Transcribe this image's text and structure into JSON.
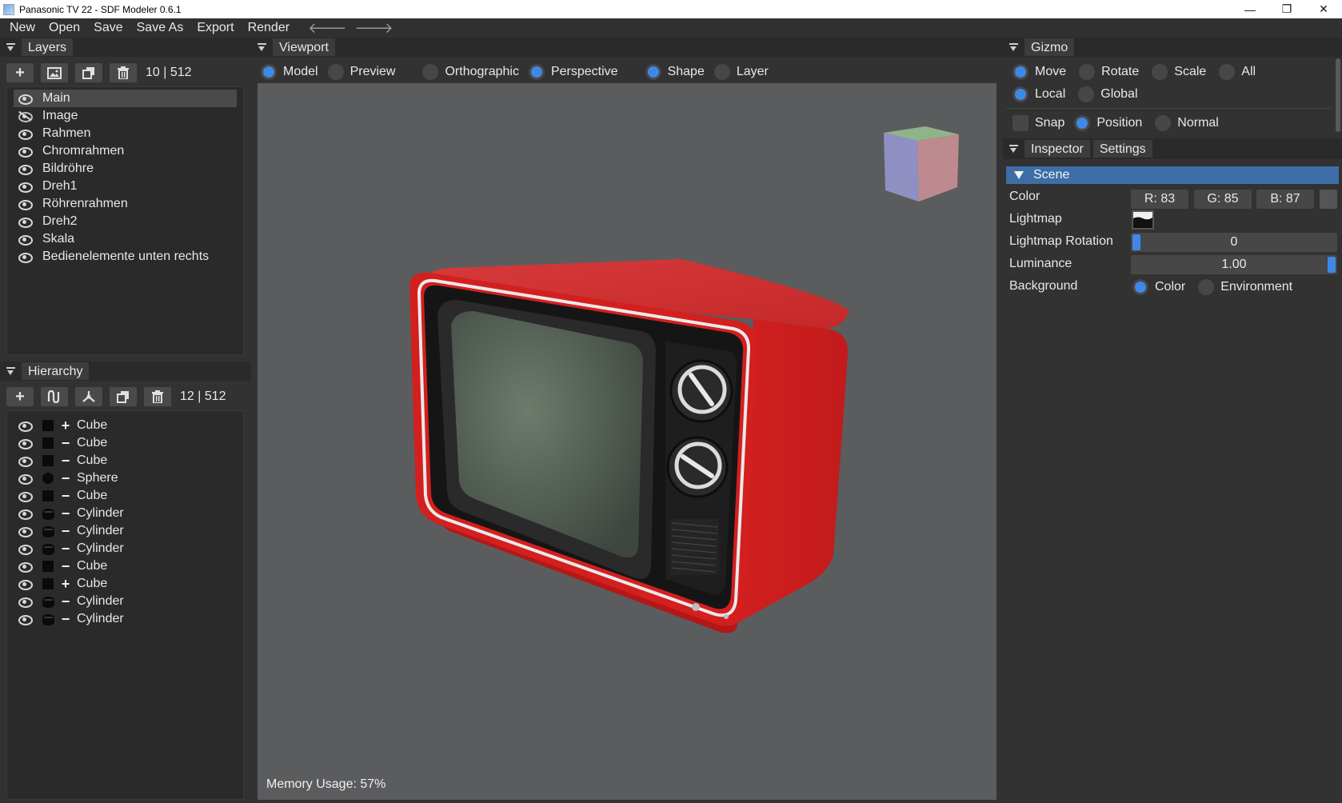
{
  "window": {
    "title": "Panasonic TV 22 - SDF Modeler 0.6.1",
    "minimize": "—",
    "maximize": "❐",
    "close": "✕"
  },
  "menu": {
    "items": [
      "New",
      "Open",
      "Save",
      "Save As",
      "Export",
      "Render"
    ],
    "back": "🡐",
    "forward": "🡒"
  },
  "layers": {
    "title": "Layers",
    "count": "10 | 512",
    "items": [
      {
        "label": "Main",
        "visible": true,
        "selected": true
      },
      {
        "label": "Image",
        "visible": false
      },
      {
        "label": "Rahmen",
        "visible": true
      },
      {
        "label": "Chromrahmen",
        "visible": true
      },
      {
        "label": "Bildröhre",
        "visible": true
      },
      {
        "label": "Dreh1",
        "visible": true
      },
      {
        "label": "Röhrenrahmen",
        "visible": true
      },
      {
        "label": "Dreh2",
        "visible": true
      },
      {
        "label": "Skala",
        "visible": true
      },
      {
        "label": "Bedienelemente unten rechts",
        "visible": true
      }
    ]
  },
  "hierarchy": {
    "title": "Hierarchy",
    "count": "12 | 512",
    "items": [
      {
        "shape": "square",
        "op": "+",
        "label": "Cube"
      },
      {
        "shape": "square",
        "op": "−",
        "label": "Cube"
      },
      {
        "shape": "square",
        "op": "−",
        "label": "Cube"
      },
      {
        "shape": "circle",
        "op": "−",
        "label": "Sphere"
      },
      {
        "shape": "square",
        "op": "−",
        "label": "Cube"
      },
      {
        "shape": "cylinder",
        "op": "−",
        "label": "Cylinder"
      },
      {
        "shape": "cylinder",
        "op": "−",
        "label": "Cylinder"
      },
      {
        "shape": "cylinder",
        "op": "−",
        "label": "Cylinder"
      },
      {
        "shape": "square",
        "op": "−",
        "label": "Cube"
      },
      {
        "shape": "square",
        "op": "+",
        "label": "Cube"
      },
      {
        "shape": "cylinder",
        "op": "−",
        "label": "Cylinder"
      },
      {
        "shape": "cylinder",
        "op": "−",
        "label": "Cylinder"
      }
    ]
  },
  "viewport": {
    "title": "Viewport",
    "options": [
      {
        "label": "Model",
        "on": true
      },
      {
        "label": "Preview",
        "on": false
      },
      {
        "label": "Orthographic",
        "on": false
      },
      {
        "label": "Perspective",
        "on": true
      },
      {
        "label": "Shape",
        "on": true
      },
      {
        "label": "Layer",
        "on": false
      }
    ],
    "memory": "Memory Usage: 57%"
  },
  "gizmo": {
    "title": "Gizmo",
    "row1": [
      {
        "label": "Move",
        "on": true
      },
      {
        "label": "Rotate",
        "on": false
      },
      {
        "label": "Scale",
        "on": false
      },
      {
        "label": "All",
        "on": false
      }
    ],
    "row2": [
      {
        "label": "Local",
        "on": true
      },
      {
        "label": "Global",
        "on": false
      }
    ],
    "snap": "Snap",
    "row3": [
      {
        "label": "Position",
        "on": true
      },
      {
        "label": "Normal",
        "on": false
      }
    ]
  },
  "inspector": {
    "tabs": [
      "Inspector",
      "Settings"
    ],
    "section": "Scene",
    "color_label": "Color",
    "color": {
      "r": "R: 83",
      "g": "G: 85",
      "b": "B: 87"
    },
    "lightmap_label": "Lightmap",
    "lightmap_rotation_label": "Lightmap Rotation",
    "lightmap_rotation": "0",
    "luminance_label": "Luminance",
    "luminance": "1.00",
    "background_label": "Background",
    "background_options": [
      {
        "label": "Color",
        "on": true
      },
      {
        "label": "Environment",
        "on": false
      }
    ]
  },
  "colors": {
    "accent": "#3f89e6",
    "tv_body": "#d42020",
    "viewport_bg": "#5b5c5e"
  }
}
